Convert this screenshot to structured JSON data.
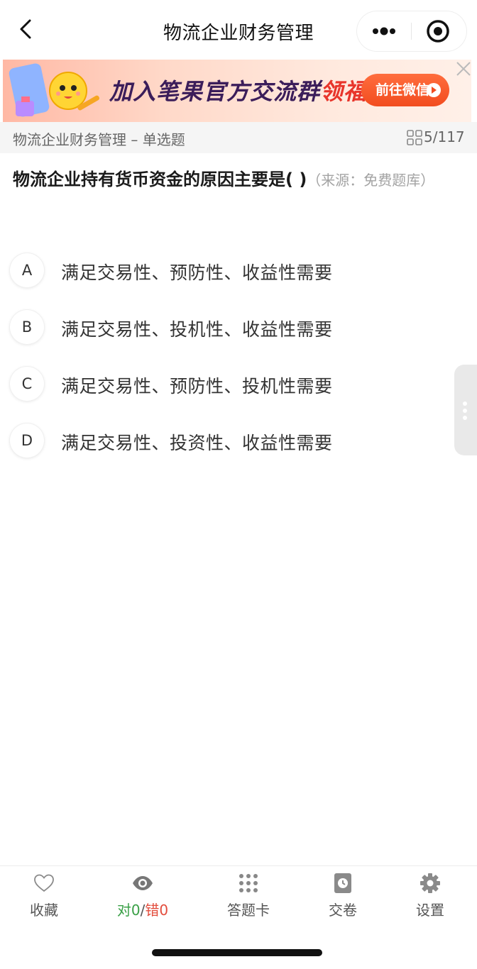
{
  "nav": {
    "title": "物流企业财务管理"
  },
  "banner": {
    "text_main": "加入笔果官方交流群",
    "text_highlight": "领福利",
    "button_label": "前往微信"
  },
  "subheader": {
    "title": "物流企业财务管理 – 单选题",
    "progress": "5/117"
  },
  "question": {
    "text": "物流企业持有货币资金的原因主要是( )",
    "source": "（来源：免费题库）"
  },
  "options": [
    {
      "letter": "A",
      "text": "满足交易性、预防性、收益性需要"
    },
    {
      "letter": "B",
      "text": "满足交易性、投机性、收益性需要"
    },
    {
      "letter": "C",
      "text": "满足交易性、预防性、投机性需要"
    },
    {
      "letter": "D",
      "text": "满足交易性、投资性、收益性需要"
    }
  ],
  "bottom_bar": {
    "favorite_label": "收藏",
    "stats": {
      "correct_label": "对",
      "correct_count": "0",
      "sep": "/",
      "wrong_label": "错",
      "wrong_count": "0"
    },
    "answer_card_label": "答题卡",
    "submit_label": "交卷",
    "settings_label": "设置"
  },
  "colors": {
    "correct": "#3aa047",
    "wrong": "#e34d3d",
    "accent": "#f24c1f"
  },
  "icons": {
    "back": "chevron-left-icon",
    "more": "more-dots-icon",
    "close_mini": "target-circle-icon",
    "banner_close": "close-icon",
    "grid": "grid-icon",
    "favorite": "heart-icon",
    "stats": "eye-icon",
    "answer_card": "dots-grid-icon",
    "submit": "clock-paper-icon",
    "settings": "gear-icon"
  }
}
